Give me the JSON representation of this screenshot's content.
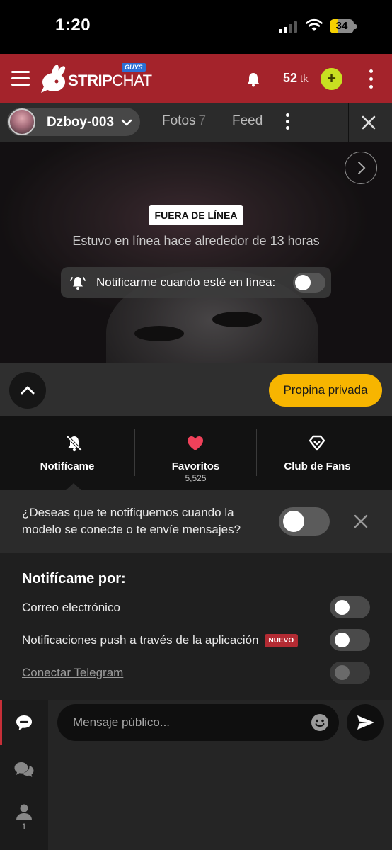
{
  "status_bar": {
    "time": "1:20",
    "battery_level": "34",
    "battery_fraction": 0.34,
    "battery_color": "#f5d000"
  },
  "header": {
    "brand_name_bold": "STRIP",
    "brand_name_light": "CHAT",
    "brand_badge": "GUYS",
    "token_count": "52",
    "token_unit": "tk",
    "accent_color": "#a4232b",
    "add_button_label": "+",
    "icons": [
      "menu-icon",
      "bunny-logo-icon",
      "bell-icon",
      "add-tokens-icon",
      "more-vertical-icon"
    ]
  },
  "model_nav": {
    "model_name": "Dzboy-003",
    "tabs": [
      {
        "label": "Fotos",
        "count": "7"
      },
      {
        "label": "Feed"
      }
    ],
    "icons": [
      "chevron-down-icon",
      "more-vertical-icon",
      "close-icon"
    ]
  },
  "stream": {
    "status_badge": "FUERA DE LÍNEA",
    "last_seen": "Estuvo en línea hace alrededor de 13 horas",
    "notify_online_label": "Notificarme cuando esté en línea:",
    "notify_online_enabled": false,
    "icons": [
      "chevron-right-icon",
      "bell-ringing-icon"
    ]
  },
  "controls": {
    "private_tip_label": "Propina privada",
    "tip_color": "#f7b500",
    "icons": [
      "chevron-up-icon"
    ]
  },
  "actions": [
    {
      "label": "Notifícame",
      "icon": "bell-off-icon"
    },
    {
      "label": "Favoritos",
      "sub": "5,525",
      "icon": "heart-icon",
      "icon_color": "#f0415a"
    },
    {
      "label": "Club de Fans",
      "icon": "diamond-icon"
    }
  ],
  "notify_prompt": {
    "text": "¿Deseas que te notifiquemos cuando la modelo se conecte o te envíe mensajes?",
    "enabled": false
  },
  "notify_by": {
    "title": "Notifícame por:",
    "rows": [
      {
        "label": "Correo electrónico",
        "enabled": false
      },
      {
        "label": "Notificaciones push a través de la aplicación",
        "badge": "NUEVO",
        "enabled": false
      },
      {
        "label": "Conectar Telegram",
        "enabled": false,
        "disabled": true
      }
    ]
  },
  "chat": {
    "placeholder": "Mensaje público...",
    "users_count": "1",
    "icons": [
      "chat-bubble-icon",
      "chat-bubbles-icon",
      "user-icon",
      "emoji-icon",
      "send-icon"
    ]
  }
}
